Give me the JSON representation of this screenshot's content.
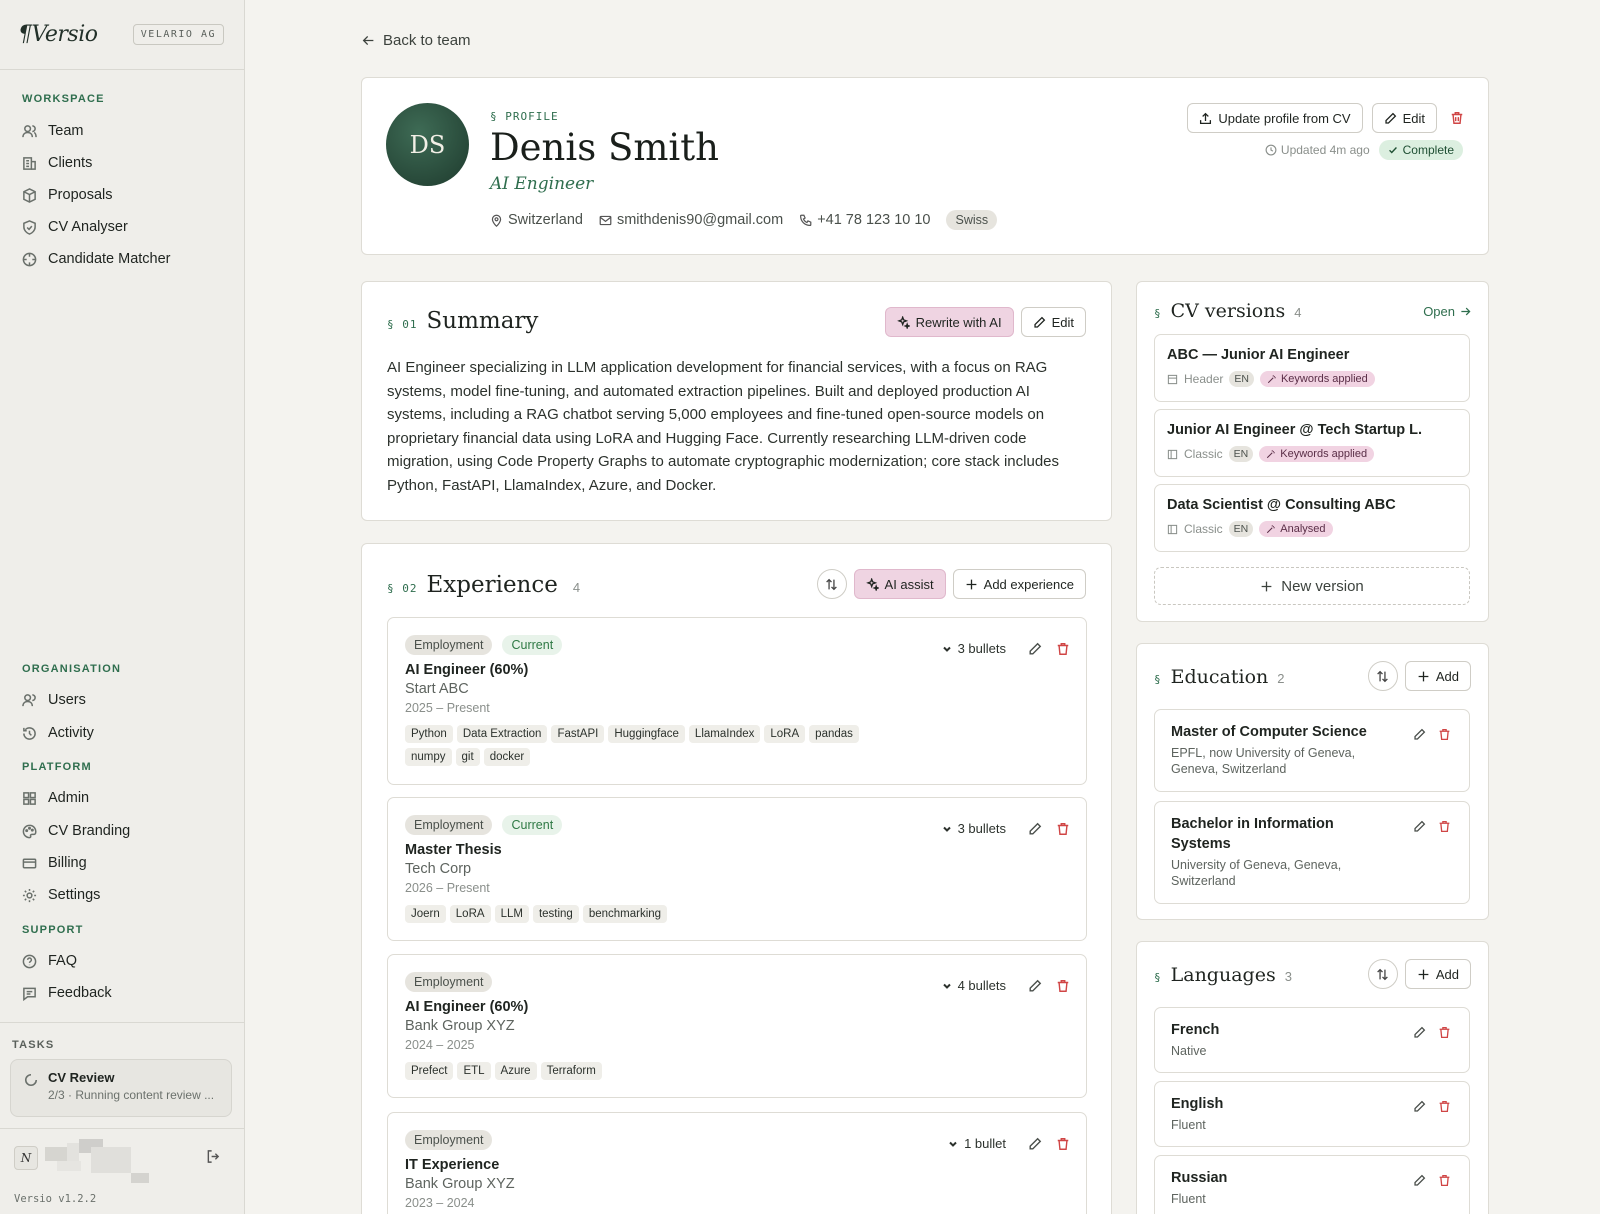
{
  "brand": {
    "logo": "¶Versio",
    "org": "VELARIO AG"
  },
  "sidebar": {
    "workspace_label": "WORKSPACE",
    "workspace": [
      "Team",
      "Clients",
      "Proposals",
      "CV Analyser",
      "Candidate Matcher"
    ],
    "organisation_label": "ORGANISATION",
    "organisation": [
      "Users",
      "Activity"
    ],
    "platform_label": "PLATFORM",
    "platform": [
      "Admin",
      "CV Branding",
      "Billing",
      "Settings"
    ],
    "support_label": "SUPPORT",
    "support": [
      "FAQ",
      "Feedback"
    ],
    "tasks_label": "TASKS",
    "task": {
      "title": "CV Review",
      "status": "2/3 · Running content review ..."
    },
    "user_initial": "N",
    "version": "Versio v1.2.2"
  },
  "back_link": "Back to team",
  "profile": {
    "section": "§ PROFILE",
    "initials": "DS",
    "name": "Denis Smith",
    "role": "AI Engineer",
    "location": "Switzerland",
    "email": "smithdenis90@gmail.com",
    "phone": "+41 78 123 10 10",
    "nationality": "Swiss",
    "update_btn": "Update profile from CV",
    "edit_btn": "Edit",
    "updated": "Updated 4m ago",
    "status": "Complete"
  },
  "summary": {
    "num": "§ 01",
    "title": "Summary",
    "rewrite_btn": "Rewrite with AI",
    "edit_btn": "Edit",
    "text": "AI Engineer specializing in LLM application development for financial services, with a focus on RAG systems, model fine-tuning, and automated extraction pipelines. Built and deployed production AI systems, including a RAG chatbot serving 5,000 employees and fine-tuned open-source models on proprietary financial data using LoRA and Hugging Face. Currently researching LLM-driven code migration, using Code Property Graphs to automate cryptographic modernization; core stack includes Python, FastAPI, LlamaIndex, Azure, and Docker."
  },
  "experience": {
    "num": "§ 02",
    "title": "Experience",
    "count": "4",
    "ai_btn": "AI assist",
    "add_btn": "Add experience",
    "items": [
      {
        "type": "Employment",
        "current": "Current",
        "bullets": "3 bullets",
        "title": "AI Engineer (60%)",
        "org": "Start ABC",
        "dates": "2025 – Present",
        "tags": [
          "Python",
          "Data Extraction",
          "FastAPI",
          "Huggingface",
          "LlamaIndex",
          "LoRA",
          "pandas",
          "numpy",
          "git",
          "docker"
        ]
      },
      {
        "type": "Employment",
        "current": "Current",
        "bullets": "3 bullets",
        "title": "Master Thesis",
        "org": "Tech Corp",
        "dates": "2026 – Present",
        "tags": [
          "Joern",
          "LoRA",
          "LLM",
          "testing",
          "benchmarking"
        ]
      },
      {
        "type": "Employment",
        "current": "",
        "bullets": "4 bullets",
        "title": "AI Engineer (60%)",
        "org": "Bank Group XYZ",
        "dates": "2024 – 2025",
        "tags": [
          "Prefect",
          "ETL",
          "Azure",
          "Terraform"
        ]
      },
      {
        "type": "Employment",
        "current": "",
        "bullets": "1 bullet",
        "title": "IT Experience",
        "org": "Bank Group XYZ",
        "dates": "2023 – 2024",
        "tags": []
      }
    ]
  },
  "cv_versions": {
    "title": "CV versions",
    "count": "4",
    "open": "Open",
    "items": [
      {
        "title": "ABC — Junior AI Engineer",
        "layout": "Header",
        "lang": "EN",
        "status": "Keywords applied"
      },
      {
        "title": "Junior AI Engineer @ Tech Startup L.",
        "layout": "Classic",
        "lang": "EN",
        "status": "Keywords applied"
      },
      {
        "title": "Data Scientist @ Consulting ABC",
        "layout": "Classic",
        "lang": "EN",
        "status": "Analysed"
      }
    ],
    "new_btn": "New version"
  },
  "education": {
    "title": "Education",
    "count": "2",
    "add_btn": "Add",
    "items": [
      {
        "title": "Master of Computer Science",
        "sub": "EPFL, now University of Geneva, Geneva, Switzerland"
      },
      {
        "title": "Bachelor in Information Systems",
        "sub": "University of Geneva, Geneva, Switzerland"
      }
    ]
  },
  "languages": {
    "title": "Languages",
    "count": "3",
    "add_btn": "Add",
    "items": [
      {
        "name": "French",
        "level": "Native"
      },
      {
        "name": "English",
        "level": "Fluent"
      },
      {
        "name": "Russian",
        "level": "Fluent"
      }
    ]
  },
  "colors": {
    "accent": "#2f6e4e",
    "ai": "#efd4e2",
    "danger": "#d04545"
  }
}
